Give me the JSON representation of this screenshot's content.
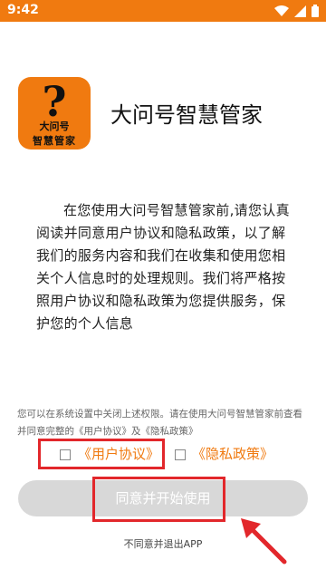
{
  "status_bar": {
    "time": "9:42",
    "icons": [
      "wifi-icon",
      "signal-icon",
      "battery-icon"
    ],
    "color": "#f07a10"
  },
  "logo": {
    "glyph": "?",
    "line1": "大问号",
    "line2": "智慧管家"
  },
  "app_name": "大问号智慧管家",
  "intro": "在您使用大问号智慧管家前,请您认真阅读并同意用户协议和隐私政策，以了解我们的服务内容和我们在收集和使用您相关个人信息时的处理规则。我们将严格按照用户协议和隐私政策为您提供服务，保护您的个人信息",
  "notice": "您可以在系统设置中关闭上述权限。请在使用大问号智慧管家前查看并同意完整的《用户协议》及《隐私政策》",
  "agreements": {
    "user_agreement": "《用户协议》",
    "privacy_policy": "《隐私政策》",
    "link_color": "#f07a10"
  },
  "buttons": {
    "start": "同意并开始使用",
    "exit": "不同意并退出APP"
  },
  "highlight_color": "#e2272b"
}
